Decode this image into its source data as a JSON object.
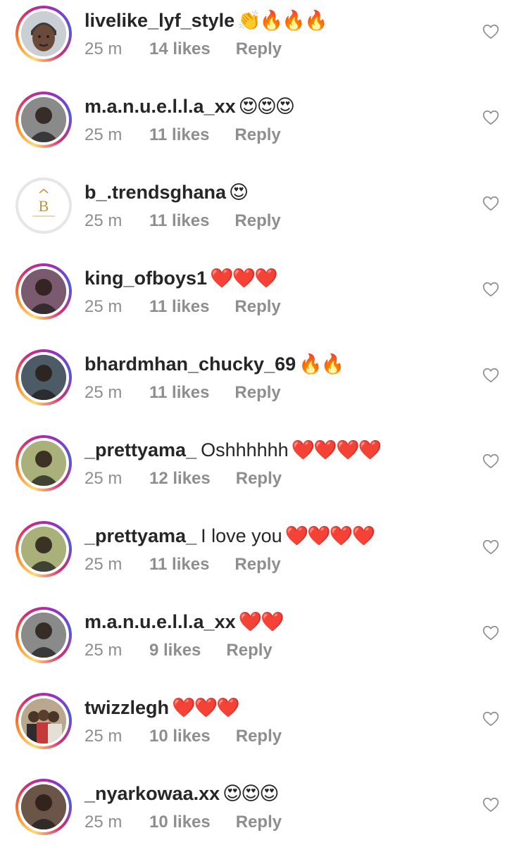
{
  "comments": [
    {
      "username": "livelike_lyf_style",
      "text": "",
      "emojis": "👏🔥🔥🔥",
      "time": "25 m",
      "likes": "14 likes",
      "reply": "Reply",
      "avatar": "man-face-avatar",
      "ring": "gradient",
      "bg": "#9aa4a8"
    },
    {
      "username": "m.a.n.u.e.l.l.a_xx",
      "text": "",
      "emojis": "😍😍😍",
      "time": "25 m",
      "likes": "11 likes",
      "reply": "Reply",
      "avatar": "person-avatar",
      "ring": "gradient",
      "bg": "#8a8a8a"
    },
    {
      "username": "b_.trendsghana",
      "text": "",
      "emojis": "😍",
      "time": "25 m",
      "likes": "11 likes",
      "reply": "Reply",
      "avatar": "brand-logo-avatar",
      "ring": "plain",
      "bg": "#ffffff"
    },
    {
      "username": "king_ofboys1",
      "text": "",
      "emojis": "❤️❤️❤️",
      "time": "25 m",
      "likes": "11 likes",
      "reply": "Reply",
      "avatar": "person-avatar",
      "ring": "gradient",
      "bg": "#7a5a6e"
    },
    {
      "username": "bhardmhan_chucky_69",
      "text": "",
      "emojis": "🔥🔥",
      "time": "25 m",
      "likes": "11 likes",
      "reply": "Reply",
      "avatar": "person-avatar",
      "ring": "gradient",
      "bg": "#4d5b66"
    },
    {
      "username": "_prettyama_",
      "text": "Oshhhhhh",
      "emojis": "❤️❤️❤️❤️",
      "time": "25 m",
      "likes": "12 likes",
      "reply": "Reply",
      "avatar": "person-avatar",
      "ring": "gradient",
      "bg": "#a9b07a"
    },
    {
      "username": "_prettyama_",
      "text": "I love you",
      "emojis": "❤️❤️❤️❤️",
      "time": "25 m",
      "likes": "11 likes",
      "reply": "Reply",
      "avatar": "person-avatar",
      "ring": "gradient",
      "bg": "#a9b07a"
    },
    {
      "username": "m.a.n.u.e.l.l.a_xx",
      "text": "",
      "emojis": "❤️❤️",
      "time": "25 m",
      "likes": "9 likes",
      "reply": "Reply",
      "avatar": "person-avatar",
      "ring": "gradient",
      "bg": "#8a8a8a"
    },
    {
      "username": "twizzlegh",
      "text": "",
      "emojis": "❤️❤️❤️",
      "time": "25 m",
      "likes": "10 likes",
      "reply": "Reply",
      "avatar": "group-photo-avatar",
      "ring": "gradient",
      "bg": "#8c7a62"
    },
    {
      "username": "_nyarkowaa.xx",
      "text": "",
      "emojis": "😍😍😍",
      "time": "25 m",
      "likes": "10 likes",
      "reply": "Reply",
      "avatar": "person-avatar",
      "ring": "gradient",
      "bg": "#6b5548"
    }
  ],
  "colors": {
    "text": "#262626",
    "secondary": "#8e8e8e",
    "heart_outline": "#8e8e8e"
  },
  "icons": {
    "like": "heart-outline-icon"
  }
}
